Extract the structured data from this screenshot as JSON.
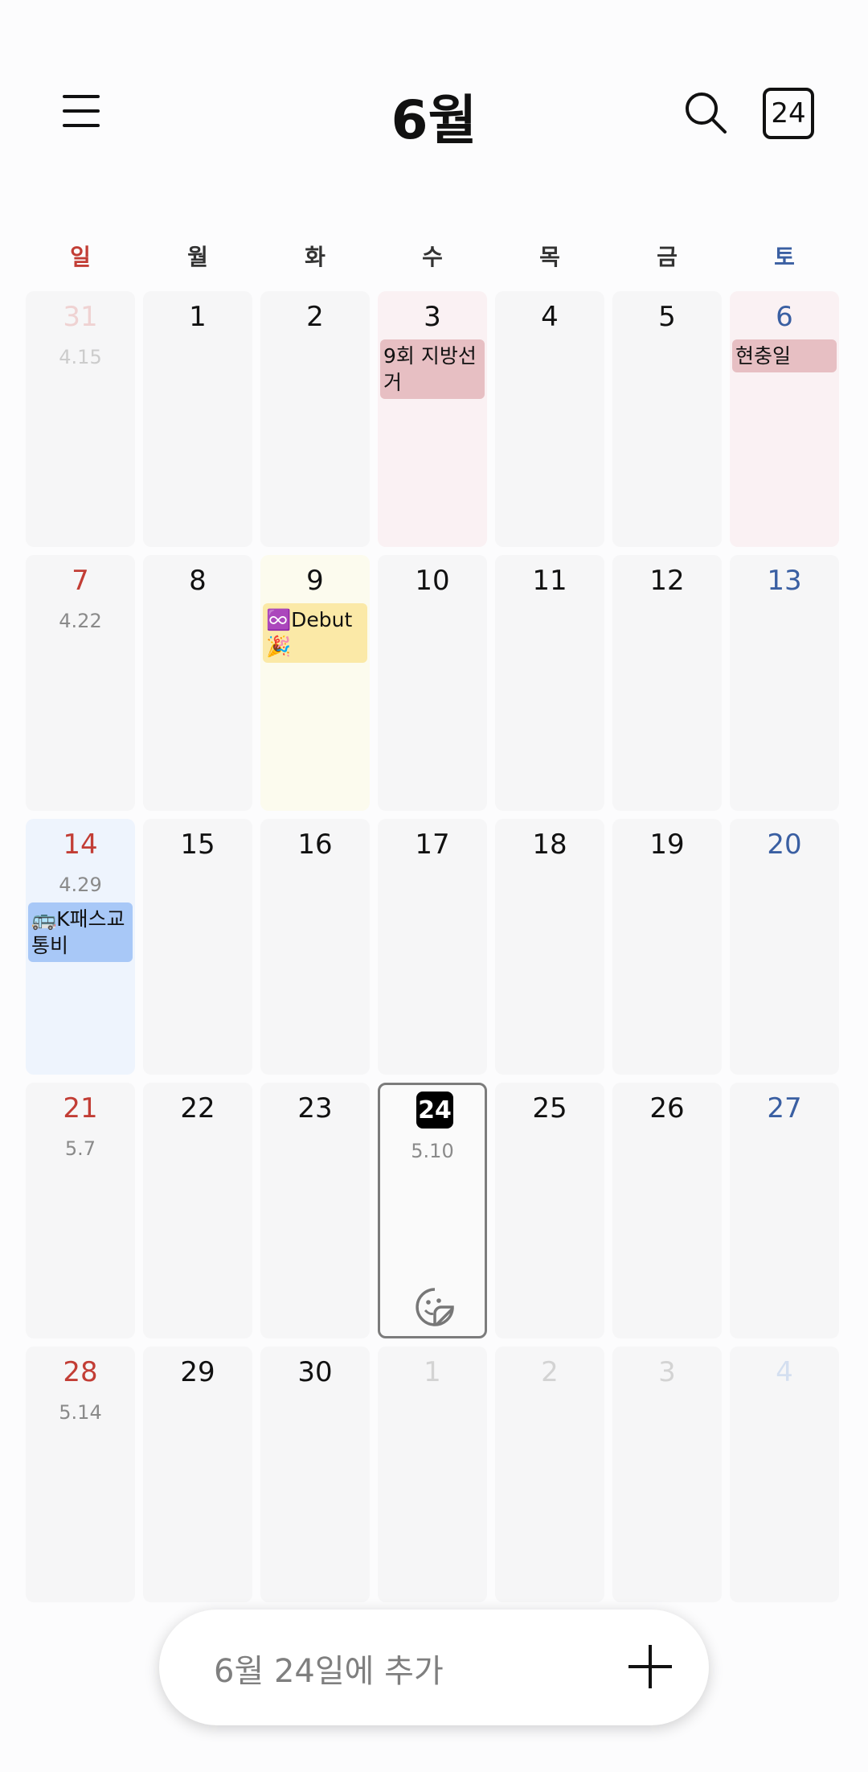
{
  "header": {
    "month": "6월",
    "today_icon_label": "24"
  },
  "weekdays": [
    "일",
    "월",
    "화",
    "수",
    "목",
    "금",
    "토"
  ],
  "weeks": [
    [
      {
        "d": "31",
        "muted": true,
        "lunar": "4.15",
        "tint": ""
      },
      {
        "d": "1",
        "tint": ""
      },
      {
        "d": "2",
        "tint": ""
      },
      {
        "d": "3",
        "tint": "pink",
        "event": {
          "text": "9회 지방선거",
          "color": "red"
        }
      },
      {
        "d": "4",
        "tint": ""
      },
      {
        "d": "5",
        "tint": ""
      },
      {
        "d": "6",
        "tint": "pink",
        "event": {
          "text": "현충일",
          "color": "red"
        }
      }
    ],
    [
      {
        "d": "7",
        "lunar": "4.22",
        "tint": ""
      },
      {
        "d": "8",
        "tint": ""
      },
      {
        "d": "9",
        "tint": "yellow",
        "event": {
          "text": "♾️Debut🎉",
          "color": "yellow"
        }
      },
      {
        "d": "10",
        "tint": ""
      },
      {
        "d": "11",
        "tint": ""
      },
      {
        "d": "12",
        "tint": ""
      },
      {
        "d": "13",
        "tint": ""
      }
    ],
    [
      {
        "d": "14",
        "lunar": "4.29",
        "tint": "blue",
        "event": {
          "text": "🚌K패스교통비",
          "color": "blue"
        }
      },
      {
        "d": "15",
        "tint": ""
      },
      {
        "d": "16",
        "tint": ""
      },
      {
        "d": "17",
        "tint": ""
      },
      {
        "d": "18",
        "tint": ""
      },
      {
        "d": "19",
        "tint": ""
      },
      {
        "d": "20",
        "tint": ""
      }
    ],
    [
      {
        "d": "21",
        "lunar": "5.7",
        "tint": ""
      },
      {
        "d": "22",
        "tint": ""
      },
      {
        "d": "23",
        "tint": ""
      },
      {
        "d": "24",
        "lunar": "5.10",
        "today": true,
        "tint": ""
      },
      {
        "d": "25",
        "tint": ""
      },
      {
        "d": "26",
        "tint": ""
      },
      {
        "d": "27",
        "tint": ""
      }
    ],
    [
      {
        "d": "28",
        "lunar": "5.14",
        "tint": ""
      },
      {
        "d": "29",
        "tint": ""
      },
      {
        "d": "30",
        "tint": ""
      },
      {
        "d": "1",
        "muted": true,
        "tint": ""
      },
      {
        "d": "2",
        "muted": true,
        "tint": ""
      },
      {
        "d": "3",
        "muted": true,
        "tint": ""
      },
      {
        "d": "4",
        "muted": true,
        "tint": ""
      }
    ]
  ],
  "add_bar": {
    "text": "6월 24일에 추가"
  },
  "colors": {
    "sunday": "#c23d35",
    "saturday": "#3a5fa2",
    "event_red": "#e7bfc3",
    "event_yellow": "#fbe9a7",
    "event_blue": "#a8c8f7"
  }
}
